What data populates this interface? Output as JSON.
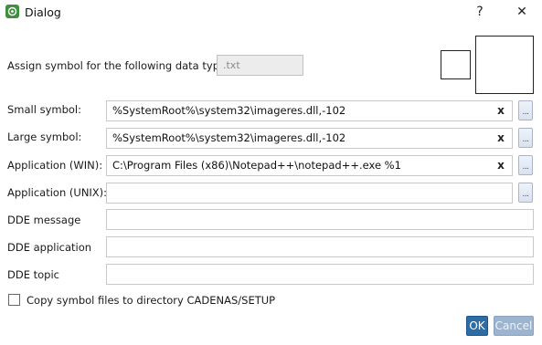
{
  "window": {
    "title": "Dialog",
    "help_glyph": "?",
    "close_glyph": "✕"
  },
  "datatype": {
    "label": "Assign symbol for the following data type:",
    "value": ".txt"
  },
  "rows": {
    "small_symbol": {
      "label": "Small symbol:",
      "value": "%SystemRoot%\\system32\\imageres.dll,-102"
    },
    "large_symbol": {
      "label": "Large symbol:",
      "value": "%SystemRoot%\\system32\\imageres.dll,-102"
    },
    "app_win": {
      "label": "Application (WIN):",
      "value": "C:\\Program Files (x86)\\Notepad++\\notepad++.exe %1"
    },
    "app_unix": {
      "label": "Application (UNIX):",
      "value": ""
    },
    "dde_message": {
      "label": "DDE message",
      "value": ""
    },
    "dde_application": {
      "label": "DDE application",
      "value": ""
    },
    "dde_topic": {
      "label": "DDE topic",
      "value": ""
    }
  },
  "clear_glyph": "x",
  "browse_glyph": "...",
  "copy_checkbox": {
    "label": "Copy symbol files to directory CADENAS/SETUP",
    "checked": false
  },
  "buttons": {
    "ok": "OK",
    "cancel": "Cancel"
  },
  "colors": {
    "ok_bg": "#2d6da6",
    "cancel_bg": "#9cb4cf",
    "app_icon": "#3f8f3f"
  }
}
